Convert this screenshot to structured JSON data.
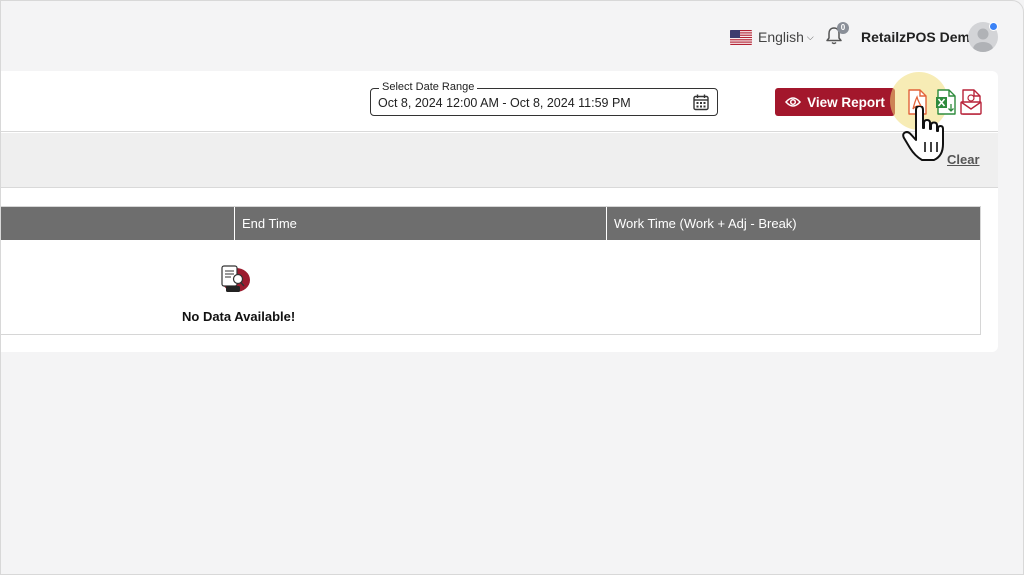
{
  "header": {
    "language": "English",
    "notification_count": "0",
    "user_name": "RetailzPOS Demo"
  },
  "report": {
    "date_range_label": "Select Date Range",
    "date_range_value": "Oct 8, 2024 12:00 AM - Oct 8, 2024 11:59 PM",
    "view_report_label": "View Report",
    "clear_label": "Clear",
    "export_icons": [
      "pdf-export-icon",
      "excel-export-icon",
      "email-export-icon"
    ]
  },
  "table": {
    "columns": [
      "End Time",
      "Work Time (Work + Adj - Break)"
    ],
    "empty_message": "No Data Available!"
  },
  "colors": {
    "accent": "#a3172c",
    "table_header": "#6e6e6e",
    "pdf": "#e2633a",
    "excel": "#2e8b3d"
  }
}
